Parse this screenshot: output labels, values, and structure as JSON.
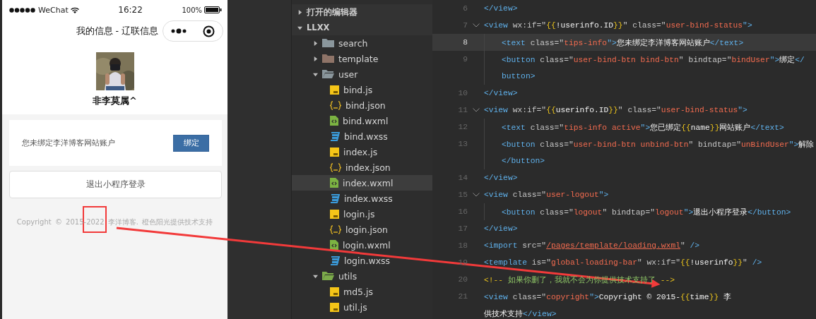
{
  "phone": {
    "status_bar": {
      "carrier": "WeChat",
      "time": "16:22",
      "battery": "100%"
    },
    "nav": {
      "title": "我的信息 - 辽联信息"
    },
    "profile": {
      "name": "非李莫属^"
    },
    "bind_card": {
      "message": "您未绑定李洋博客网站账户",
      "button": "绑定"
    },
    "logout_button": "退出小程序登录",
    "copyright": "Copyright © 2015-2022 李洋博客. 橙色阳光提供技术支持"
  },
  "explorer": {
    "sections": [
      {
        "label": "打开的编辑器",
        "expanded": false
      },
      {
        "label": "LLXX",
        "expanded": true,
        "children": [
          {
            "label": "search",
            "kind": "folder",
            "color": "#8a969c",
            "expanded": false
          },
          {
            "label": "template",
            "kind": "folder",
            "color": "#8f7468",
            "expanded": false
          },
          {
            "label": "user",
            "kind": "folder",
            "color": "#8a969c",
            "expanded": true,
            "children": [
              {
                "label": "bind.js",
                "kind": "js",
                "selected": false
              },
              {
                "label": "bind.json",
                "kind": "json",
                "selected": false
              },
              {
                "label": "bind.wxml",
                "kind": "wxml",
                "selected": false
              },
              {
                "label": "bind.wxss",
                "kind": "wxss",
                "selected": false
              },
              {
                "label": "index.js",
                "kind": "js",
                "selected": false
              },
              {
                "label": "index.json",
                "kind": "json",
                "selected": false
              },
              {
                "label": "index.wxml",
                "kind": "wxml",
                "selected": true
              },
              {
                "label": "index.wxss",
                "kind": "wxss",
                "selected": false
              },
              {
                "label": "login.js",
                "kind": "js",
                "selected": false
              },
              {
                "label": "login.json",
                "kind": "json",
                "selected": false
              },
              {
                "label": "login.wxml",
                "kind": "wxml",
                "selected": false
              },
              {
                "label": "login.wxss",
                "kind": "wxss",
                "selected": false
              }
            ]
          },
          {
            "label": "utils",
            "kind": "folder",
            "color": "#7cab4a",
            "expanded": true,
            "children": [
              {
                "label": "md5.js",
                "kind": "js",
                "selected": false
              },
              {
                "label": "util.js",
                "kind": "js",
                "selected": false
              }
            ]
          }
        ]
      }
    ]
  },
  "editor": {
    "lines": [
      {
        "number": "6",
        "fold": false,
        "current": false,
        "tokens": [
          {
            "kind": "tag",
            "text": "</view>"
          }
        ]
      },
      {
        "number": "7",
        "fold": true,
        "current": false,
        "tokens": [
          {
            "kind": "tag",
            "text": "<view"
          },
          {
            "kind": "attr",
            "text": " wx:if=\""
          },
          {
            "kind": "brace",
            "text": "{{"
          },
          {
            "kind": "text",
            "text": "!userinfo.ID"
          },
          {
            "kind": "brace",
            "text": "}}"
          },
          {
            "kind": "attr",
            "text": "\" class=\""
          },
          {
            "kind": "string",
            "text": "user-bind-status"
          },
          {
            "kind": "tag",
            "text": "\">"
          }
        ],
        "children": [
          {
            "number": "8",
            "fold": false,
            "current": true,
            "tokens": [
              {
                "kind": "tag",
                "text": "<text"
              },
              {
                "kind": "attr",
                "text": " class=\""
              },
              {
                "kind": "string",
                "text": "tips-info"
              },
              {
                "kind": "tag",
                "text": "\">"
              },
              {
                "kind": "text",
                "text": "您未绑定李洋博客网站账户"
              },
              {
                "kind": "tag",
                "text": "</text>"
              }
            ]
          },
          {
            "number": "9",
            "fold": false,
            "current": false,
            "tokens": [
              {
                "kind": "tag",
                "text": "<button"
              },
              {
                "kind": "attr",
                "text": " class=\""
              },
              {
                "kind": "string",
                "text": "user-bind-btn bind-btn"
              },
              {
                "kind": "attr",
                "text": "\" bindtap=\""
              },
              {
                "kind": "string",
                "text": "bindUser"
              },
              {
                "kind": "tag",
                "text": "\">"
              },
              {
                "kind": "text",
                "text": "绑定"
              },
              {
                "kind": "tag",
                "text": "</"
              }
            ],
            "wrap": [
              {
                "kind": "tag",
                "text": "button>"
              }
            ]
          }
        ]
      },
      {
        "number": "10",
        "fold": false,
        "current": false,
        "tokens": [
          {
            "kind": "tag",
            "text": "</view>"
          }
        ]
      },
      {
        "number": "11",
        "fold": true,
        "current": false,
        "tokens": [
          {
            "kind": "tag",
            "text": "<view"
          },
          {
            "kind": "attr",
            "text": " wx:if=\""
          },
          {
            "kind": "brace",
            "text": "{{"
          },
          {
            "kind": "text",
            "text": "userinfo.ID"
          },
          {
            "kind": "brace",
            "text": "}}"
          },
          {
            "kind": "attr",
            "text": "\" class=\""
          },
          {
            "kind": "string",
            "text": "user-bind-status"
          },
          {
            "kind": "tag",
            "text": "\">"
          }
        ],
        "children": [
          {
            "number": "12",
            "fold": false,
            "current": false,
            "tokens": [
              {
                "kind": "tag",
                "text": "<text"
              },
              {
                "kind": "attr",
                "text": " class=\""
              },
              {
                "kind": "string",
                "text": "tips-info active"
              },
              {
                "kind": "tag",
                "text": "\">"
              },
              {
                "kind": "text",
                "text": "您已绑定"
              },
              {
                "kind": "brace",
                "text": "{{"
              },
              {
                "kind": "text",
                "text": "name"
              },
              {
                "kind": "brace",
                "text": "}}"
              },
              {
                "kind": "text",
                "text": "网站账户"
              },
              {
                "kind": "tag",
                "text": "</text>"
              }
            ]
          },
          {
            "number": "13",
            "fold": false,
            "current": false,
            "tokens": [
              {
                "kind": "tag",
                "text": "<button"
              },
              {
                "kind": "attr",
                "text": " class=\""
              },
              {
                "kind": "string",
                "text": "user-bind-btn unbind-btn"
              },
              {
                "kind": "attr",
                "text": "\" bindtap=\""
              },
              {
                "kind": "string",
                "text": "unBindUser"
              },
              {
                "kind": "tag",
                "text": "\">"
              },
              {
                "kind": "text",
                "text": "解除"
              }
            ],
            "wrap": [
              {
                "kind": "tag",
                "text": "</button>"
              }
            ]
          }
        ]
      },
      {
        "number": "14",
        "fold": false,
        "current": false,
        "tokens": [
          {
            "kind": "tag",
            "text": "</view>"
          }
        ]
      },
      {
        "number": "15",
        "fold": true,
        "current": false,
        "tokens": [
          {
            "kind": "tag",
            "text": "<view"
          },
          {
            "kind": "attr",
            "text": " class=\""
          },
          {
            "kind": "string",
            "text": "user-logout"
          },
          {
            "kind": "tag",
            "text": "\">"
          }
        ],
        "children": [
          {
            "number": "16",
            "fold": false,
            "current": false,
            "tokens": [
              {
                "kind": "tag",
                "text": "<button"
              },
              {
                "kind": "attr",
                "text": " class=\""
              },
              {
                "kind": "string",
                "text": "logout"
              },
              {
                "kind": "attr",
                "text": "\" bindtap=\""
              },
              {
                "kind": "string",
                "text": "logout"
              },
              {
                "kind": "tag",
                "text": "\">"
              },
              {
                "kind": "text",
                "text": "退出小程序登录"
              },
              {
                "kind": "tag",
                "text": "</button>"
              }
            ]
          }
        ]
      },
      {
        "number": "17",
        "fold": false,
        "current": false,
        "tokens": [
          {
            "kind": "tag",
            "text": "</view>"
          }
        ]
      },
      {
        "number": "18",
        "fold": false,
        "current": false,
        "tokens": [
          {
            "kind": "tag",
            "text": "<import"
          },
          {
            "kind": "attr",
            "text": " src=\""
          },
          {
            "kind": "link",
            "text": "/pages/template/loading.wxml"
          },
          {
            "kind": "attr",
            "text": "\" "
          },
          {
            "kind": "tag",
            "text": "/>"
          }
        ]
      },
      {
        "number": "19",
        "fold": false,
        "current": false,
        "tokens": [
          {
            "kind": "tag",
            "text": "<template"
          },
          {
            "kind": "attr",
            "text": " is=\""
          },
          {
            "kind": "string",
            "text": "global-loading-bar"
          },
          {
            "kind": "attr",
            "text": "\" wx:if=\""
          },
          {
            "kind": "brace",
            "text": "{{"
          },
          {
            "kind": "text",
            "text": "!userinfo"
          },
          {
            "kind": "brace",
            "text": "}}"
          },
          {
            "kind": "attr",
            "text": "\" "
          },
          {
            "kind": "tag",
            "text": "/>"
          }
        ]
      },
      {
        "number": "20",
        "fold": false,
        "current": false,
        "tokens": [
          {
            "kind": "mark",
            "text": "<!--"
          },
          {
            "kind": "comment",
            "text": " 如果你删了，我就不会为你提供技术支持了 "
          },
          {
            "kind": "mark",
            "text": "-->"
          }
        ]
      },
      {
        "number": "21",
        "fold": false,
        "current": false,
        "tokens": [
          {
            "kind": "tag",
            "text": "<view"
          },
          {
            "kind": "attr",
            "text": " class=\""
          },
          {
            "kind": "string",
            "text": "copyright"
          },
          {
            "kind": "tag",
            "text": "\">"
          },
          {
            "kind": "text",
            "text": "Copyright © 2015-"
          },
          {
            "kind": "brace",
            "text": "{{"
          },
          {
            "kind": "text",
            "text": "time"
          },
          {
            "kind": "brace",
            "text": "}}"
          },
          {
            "kind": "text",
            "text": " 李"
          }
        ],
        "wrap": [
          {
            "kind": "text",
            "text": "供技术支持"
          },
          {
            "kind": "tag",
            "text": "</view>"
          }
        ]
      }
    ]
  }
}
